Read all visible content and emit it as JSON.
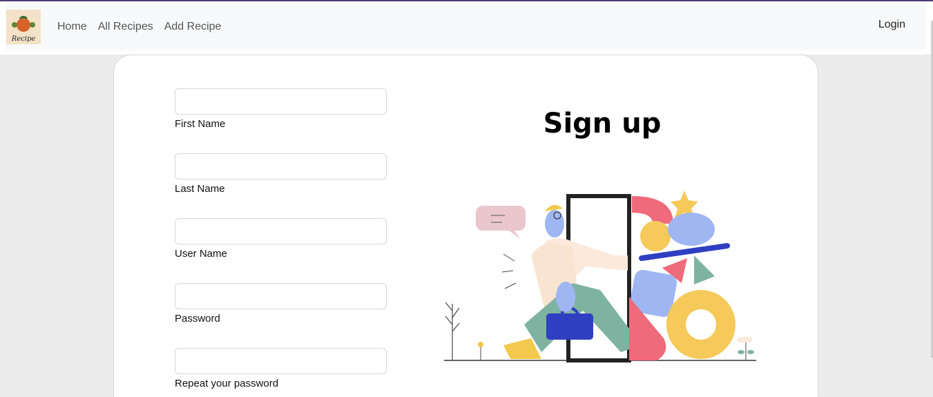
{
  "nav": {
    "logo_alt": "Recipe",
    "links": [
      "Home",
      "All Recipes",
      "Add Recipe"
    ],
    "login": "Login"
  },
  "form": {
    "fields": [
      {
        "label": "First Name",
        "value": ""
      },
      {
        "label": "Last Name",
        "value": ""
      },
      {
        "label": "User Name",
        "value": ""
      },
      {
        "label": "Password",
        "value": ""
      },
      {
        "label": "Repeat your password",
        "value": ""
      }
    ]
  },
  "signup": {
    "title": "Sign up"
  },
  "colors": {
    "navbar_bg": "#f8f9fa",
    "page_bg": "#ececec",
    "card_bg": "#ffffff",
    "accent_top": "#4b3a6e"
  }
}
